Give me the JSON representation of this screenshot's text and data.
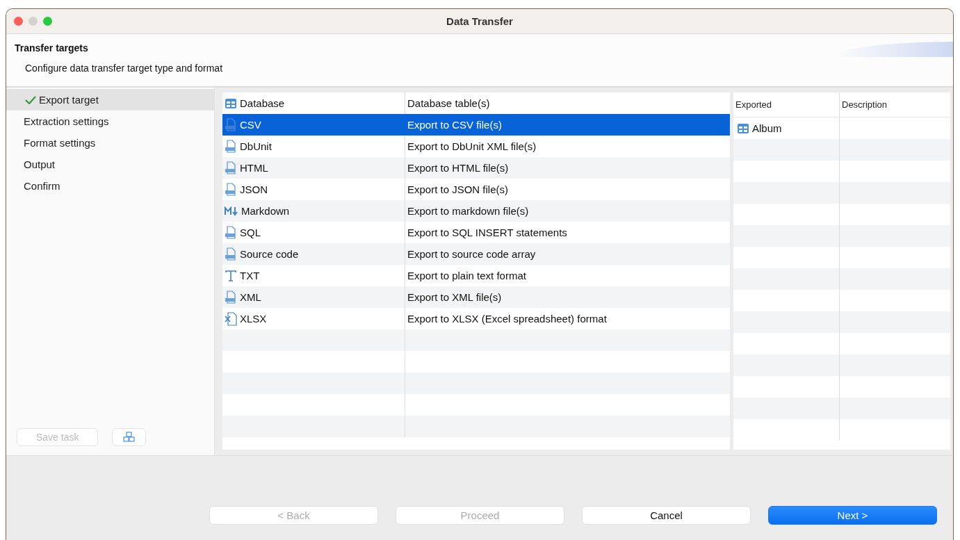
{
  "window": {
    "title": "Data Transfer"
  },
  "header": {
    "title": "Transfer targets",
    "subtitle": "Configure data transfer target type and format"
  },
  "sidebar": {
    "items": [
      {
        "label": "Export target",
        "selected": true,
        "checked": true
      },
      {
        "label": "Extraction settings",
        "selected": false,
        "checked": false
      },
      {
        "label": "Format settings",
        "selected": false,
        "checked": false
      },
      {
        "label": "Output",
        "selected": false,
        "checked": false
      },
      {
        "label": "Confirm",
        "selected": false,
        "checked": false
      }
    ],
    "save_task": {
      "label": "Save task",
      "disabled": true
    }
  },
  "targets": {
    "rows": [
      {
        "name": "Database",
        "description": "Database table(s)",
        "kind": "table",
        "selected": false
      },
      {
        "name": "CSV",
        "description": "Export to CSV file(s)",
        "kind": "file",
        "selected": true
      },
      {
        "name": "DbUnit",
        "description": "Export to DbUnit XML file(s)",
        "kind": "file",
        "selected": false
      },
      {
        "name": "HTML",
        "description": "Export to HTML file(s)",
        "kind": "file",
        "selected": false
      },
      {
        "name": "JSON",
        "description": "Export to JSON file(s)",
        "kind": "file",
        "selected": false
      },
      {
        "name": "Markdown",
        "description": "Export to markdown file(s)",
        "kind": "markdown",
        "selected": false
      },
      {
        "name": "SQL",
        "description": "Export to SQL INSERT statements",
        "kind": "file",
        "selected": false
      },
      {
        "name": "Source code",
        "description": "Export to source code array",
        "kind": "file",
        "selected": false
      },
      {
        "name": "TXT",
        "description": "Export to plain text format",
        "kind": "text",
        "selected": false
      },
      {
        "name": "XML",
        "description": "Export to XML file(s)",
        "kind": "file",
        "selected": false
      },
      {
        "name": "XLSX",
        "description": "Export to XLSX (Excel spreadsheet) format",
        "kind": "spreadsheet",
        "selected": false
      }
    ]
  },
  "exported": {
    "columns": [
      "Exported",
      "Description"
    ],
    "rows": [
      {
        "name": "Album"
      }
    ]
  },
  "buttons": [
    {
      "label": "< Back",
      "disabled": true,
      "primary": false
    },
    {
      "label": "Proceed",
      "disabled": true,
      "primary": false
    },
    {
      "label": "Cancel",
      "disabled": false,
      "primary": false
    },
    {
      "label": "Next >",
      "disabled": false,
      "primary": true
    }
  ]
}
